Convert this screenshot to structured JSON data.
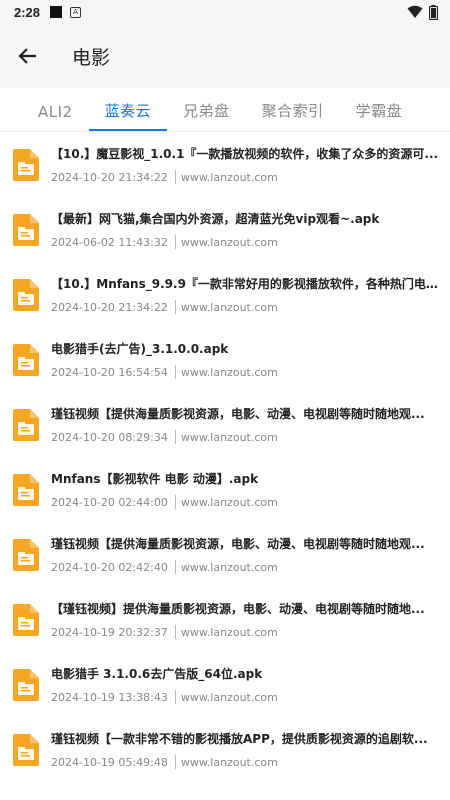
{
  "status": {
    "time": "2:28"
  },
  "header": {
    "title": "电影"
  },
  "tabs": [
    {
      "label": "ALI2"
    },
    {
      "label": "蓝奏云"
    },
    {
      "label": "兄弟盘"
    },
    {
      "label": "聚合索引"
    },
    {
      "label": "学霸盘"
    }
  ],
  "active_tab": 1,
  "items": [
    {
      "title": "【10.】魔豆影视_1.0.1『一款播放视频的软件，收集了众多的资源可...",
      "date": "2024-10-20 21:34:22",
      "source": "www.lanzout.com"
    },
    {
      "title": "【最新】网飞猫,集合国内外资源，超清蓝光免vip观看~.apk",
      "date": "2024-06-02 11:43:32",
      "source": "www.lanzout.com"
    },
    {
      "title": "【10.】Mnfans_9.9.9『一款非常好用的影视播放软件，各种热门电视...",
      "date": "2024-10-20 21:34:22",
      "source": "www.lanzout.com"
    },
    {
      "title": "电影猎手(去广告)_3.1.0.0.apk",
      "date": "2024-10-20 16:54:54",
      "source": "www.lanzout.com"
    },
    {
      "title": "瑾钰视频【提供海量质影视资源，电影、动漫、电视剧等随时随地观...",
      "date": "2024-10-20 08:29:34",
      "source": "www.lanzout.com"
    },
    {
      "title": "Mnfans【影视软件 电影 动漫】.apk",
      "date": "2024-10-20 02:44:00",
      "source": "www.lanzout.com"
    },
    {
      "title": "瑾钰视频【提供海量质影视资源，电影、动漫、电视剧等随时随地观...",
      "date": "2024-10-20 02:42:40",
      "source": "www.lanzout.com"
    },
    {
      "title": "【瑾钰视频】提供海量质影视资源，电影、动漫、电视剧等随时随地...",
      "date": "2024-10-19 20:32:37",
      "source": "www.lanzout.com"
    },
    {
      "title": "电影猎手 3.1.0.6去广告版_64位.apk",
      "date": "2024-10-19 13:38:43",
      "source": "www.lanzout.com"
    },
    {
      "title": "瑾钰视频【一款非常不错的影视播放APP，提供质影视资源的追剧软...",
      "date": "2024-10-19 05:49:48",
      "source": "www.lanzout.com"
    }
  ],
  "colors": {
    "accent": "#1a73e8",
    "file_icon": "#f5a623"
  }
}
